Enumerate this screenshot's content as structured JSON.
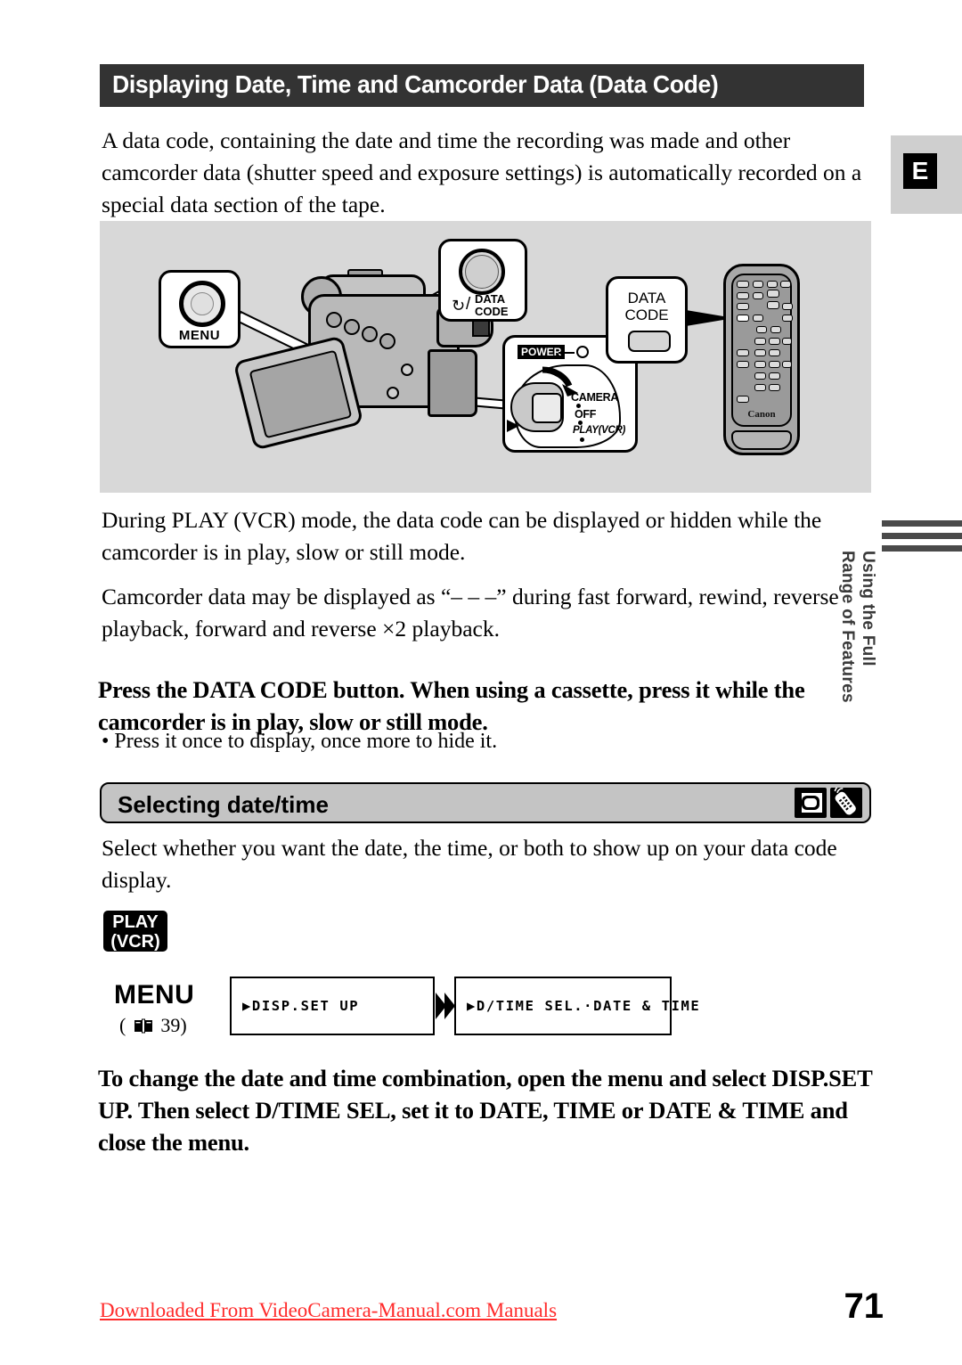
{
  "page": {
    "title": "Displaying Date, Time and Camcorder Data (Data Code)",
    "number": "71",
    "language_tab": "E",
    "side_marker": "Using the Full\nRange of Features"
  },
  "paragraphs": {
    "intro": "A data code, containing the date and time the recording was made and other camcorder data (shutter speed and exposure settings) is automatically recorded on a special data section of the tape.",
    "during_play": "During PLAY (VCR) mode, the data code can be displayed or hidden while the camcorder is in play, slow or still mode.",
    "dashes": "Camcorder data may be displayed as “– – –” during fast forward, rewind, reverse playback, forward and reverse ×2 playback."
  },
  "instructions": {
    "press_data_code": "Press the DATA CODE button. When using a cassette, press it while the camcorder is in play, slow or still mode.",
    "press_bullet": "• Press it once to display, once more to hide it.",
    "change_combination": "To change the date and time combination, open the menu and select DISP.SET UP. Then select D/TIME SEL, set it to DATE, TIME or DATE & TIME and close the menu."
  },
  "illustration": {
    "menu_callout": "MENU",
    "data_code_callout_line1": "DATA",
    "data_code_callout_line2": "CODE",
    "self_timer_glyph": "↻",
    "slash": "/",
    "power_label": "POWER",
    "power_modes": [
      "CAMERA",
      "OFF",
      "PLAY(VCR)"
    ],
    "remote_callout_line1": "DATA",
    "remote_callout_line2": "CODE",
    "remote_brand": "Canon"
  },
  "section": {
    "title": "Selecting date/time",
    "description": "Select whether you want the date, the time, or both to show up on your data code display.",
    "icons": [
      "camcorder-icon",
      "wireless-remote-icon"
    ]
  },
  "menu_flow": {
    "mode_badge_line1": "PLAY",
    "mode_badge_line2": "(VCR)",
    "menu_label": "MENU",
    "page_ref_open": "(",
    "page_ref_number": "39",
    "page_ref_close": ")",
    "step1": "▶DISP.SET UP",
    "step2": "▶D/TIME SEL.·DATE & TIME"
  },
  "footer": {
    "link": "Downloaded From VideoCamera-Manual.com Manuals"
  },
  "colors": {
    "title_bar": "#333333",
    "illustration_bg": "#d8d8d8",
    "section_bar": "#c4c4c4",
    "footer_link": "#ff2b2b",
    "side_marker": "#3a3a3a"
  }
}
